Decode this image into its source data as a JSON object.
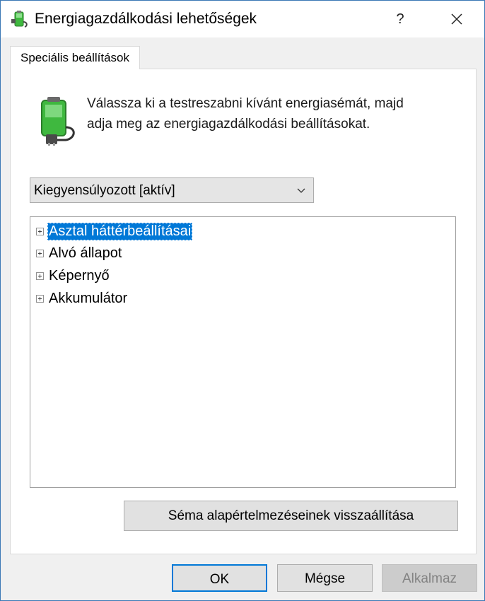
{
  "window": {
    "title": "Energiagazdálkodási lehetőségek",
    "help_label": "?",
    "icon": "battery-plug-icon"
  },
  "tabs": [
    {
      "label": "Speciális beállítások",
      "active": true
    }
  ],
  "panel": {
    "description_line1": "Válassza ki a testreszabni kívánt energiasémát, majd",
    "description_line2": "adja meg az energiagazdálkodási beállításokat.",
    "scheme_select": {
      "value": "Kiegyensúlyozott [aktív]",
      "icon": "chevron-down-icon"
    },
    "tree_items": [
      {
        "label": "Asztal háttérbeállításai",
        "selected": true
      },
      {
        "label": "Alvó állapot",
        "selected": false
      },
      {
        "label": "Képernyő",
        "selected": false
      },
      {
        "label": "Akkumulátor",
        "selected": false
      }
    ],
    "restore_button": "Séma alapértelmezéseinek visszaállítása"
  },
  "footer": {
    "ok": "OK",
    "cancel": "Mégse",
    "apply": "Alkalmaz"
  },
  "colors": {
    "accent": "#0078d7",
    "window_border": "#3b78b5",
    "battery_green": "#3fb83f"
  }
}
